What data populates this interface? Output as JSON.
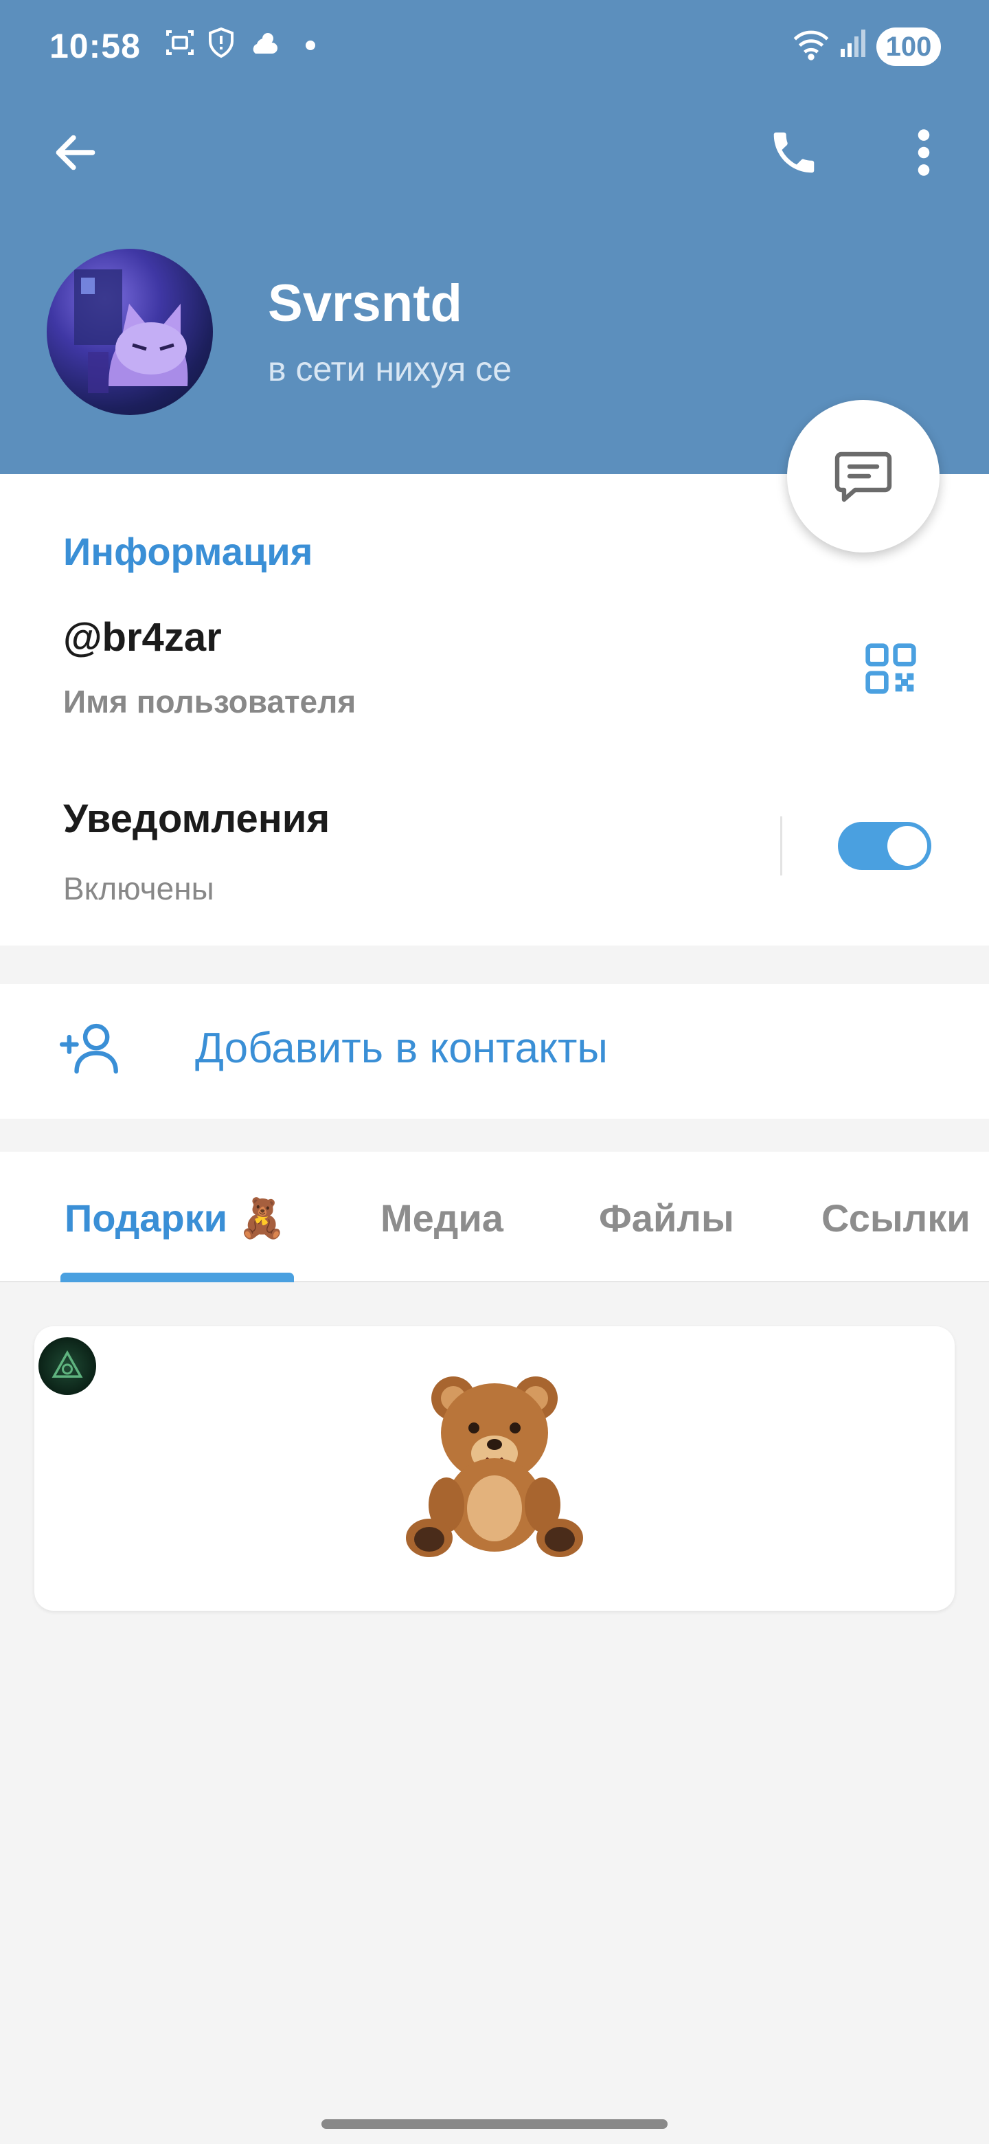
{
  "statusbar": {
    "time": "10:58",
    "battery": "100",
    "icons": [
      "screenshot-icon",
      "shield-icon",
      "weather-icon",
      "dot-icon",
      "wifi-icon",
      "signal-icon"
    ]
  },
  "toolbar": {
    "back_icon": "back-arrow-icon",
    "call_icon": "phone-icon",
    "menu_icon": "more-vertical-icon"
  },
  "profile": {
    "name": "Svrsntd",
    "status": "в сети нихуя се"
  },
  "info": {
    "section_title": "Информация",
    "username": "@br4zar",
    "username_label": "Имя пользователя",
    "notifications_title": "Уведомления",
    "notifications_status": "Включены",
    "notifications_enabled": true
  },
  "actions": {
    "add_contact": "Добавить в контакты"
  },
  "tabs": [
    {
      "label": "Подарки 🧸",
      "active": true
    },
    {
      "label": "Медиа",
      "active": false
    },
    {
      "label": "Файлы",
      "active": false
    },
    {
      "label": "Ссылки",
      "active": false
    }
  ],
  "gifts": [
    {
      "emoji": "🧸"
    }
  ],
  "colors": {
    "header": "#5c8fbd",
    "accent": "#3a8fd6",
    "toggle": "#4aa0e0"
  }
}
